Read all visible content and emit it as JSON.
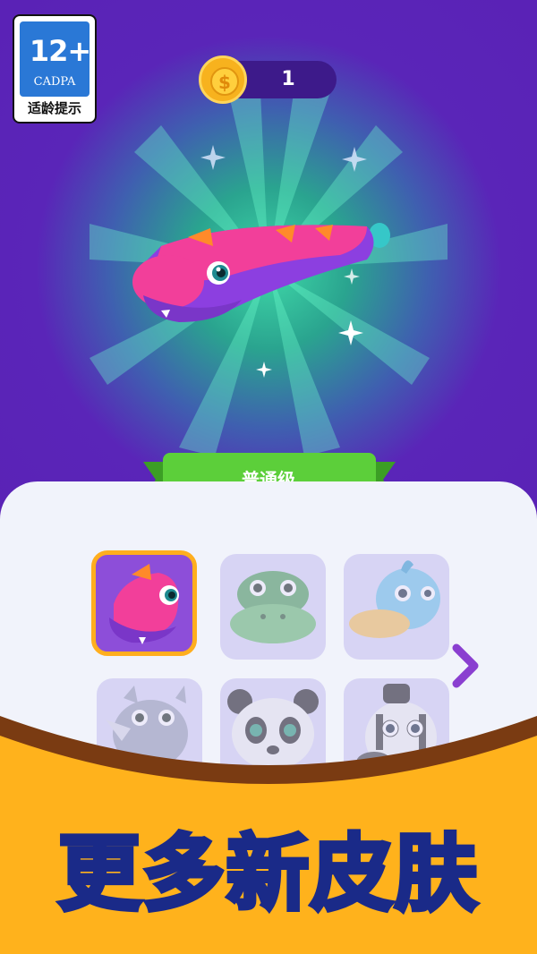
{
  "age_rating": {
    "number": "12+",
    "org": "CADPA",
    "tip": "适龄提示"
  },
  "currency": {
    "coin_count": "1",
    "icon": "coin-icon"
  },
  "skin": {
    "rank_label": "普通级",
    "preview": "dragon-snake"
  },
  "skins": [
    {
      "name": "pink-dragon",
      "selected": true,
      "locked": false
    },
    {
      "name": "crocodile",
      "selected": false,
      "locked": true
    },
    {
      "name": "duck",
      "selected": false,
      "locked": true
    },
    {
      "name": "rhino",
      "selected": false,
      "locked": true
    },
    {
      "name": "panda",
      "selected": false,
      "locked": true
    },
    {
      "name": "zebra",
      "selected": false,
      "locked": true
    }
  ],
  "nav": {
    "next_icon": "chevron-right-icon"
  },
  "promo": {
    "text": "更多新皮肤"
  },
  "colors": {
    "purple_bg": "#5a22b6",
    "green_ribbon": "#5ccf3a",
    "selected_border": "#ffae1e",
    "banner_orange": "#ffb21c",
    "promo_text": "#4fd6ff"
  }
}
